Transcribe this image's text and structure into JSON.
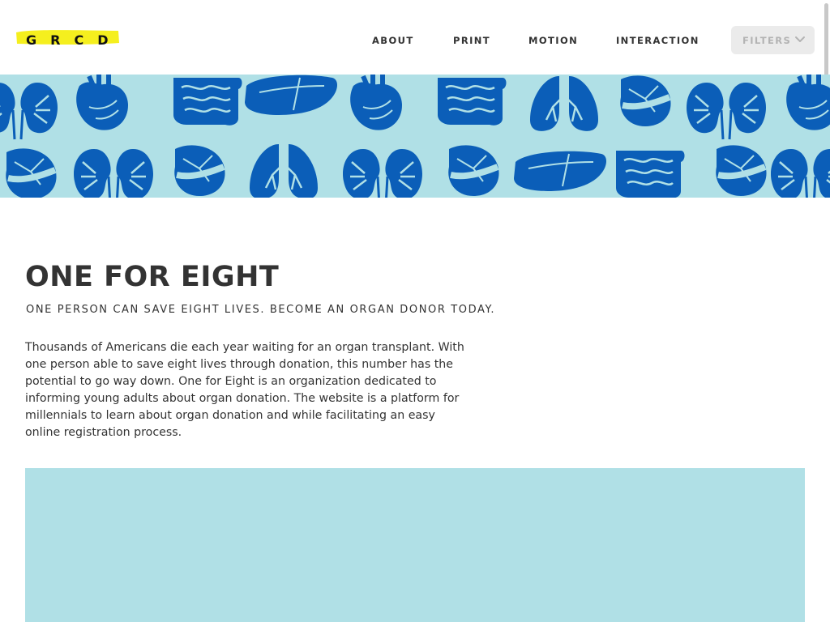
{
  "header": {
    "logo_text": "GRCD",
    "nav": [
      {
        "label": "ABOUT"
      },
      {
        "label": "PRINT"
      },
      {
        "label": "MOTION"
      },
      {
        "label": "INTERACTION"
      }
    ],
    "filters_label": "FILTERS"
  },
  "banner": {
    "background_color": "#b0e0e6",
    "illustration_color": "#0b5eb8",
    "organs": [
      "kidneys",
      "heart",
      "intestines",
      "liver",
      "lungs",
      "stomach-pancreas"
    ]
  },
  "project": {
    "title": "ONE FOR EIGHT",
    "subtitle": "ONE PERSON CAN SAVE EIGHT LIVES. BECOME AN ORGAN DONOR TODAY.",
    "description": "Thousands of Americans die each year waiting for an organ transplant. With one person able to save eight lives through donation, this number has the potential to go way down. One for Eight is an organization dedicated to informing young adults about organ donation. The website is a platform for millennials to learn about organ donation and while facilitating an easy online registration process."
  },
  "colors": {
    "accent_highlight": "#f5ef1e",
    "text": "#333333",
    "panel": "#b0e0e6"
  }
}
